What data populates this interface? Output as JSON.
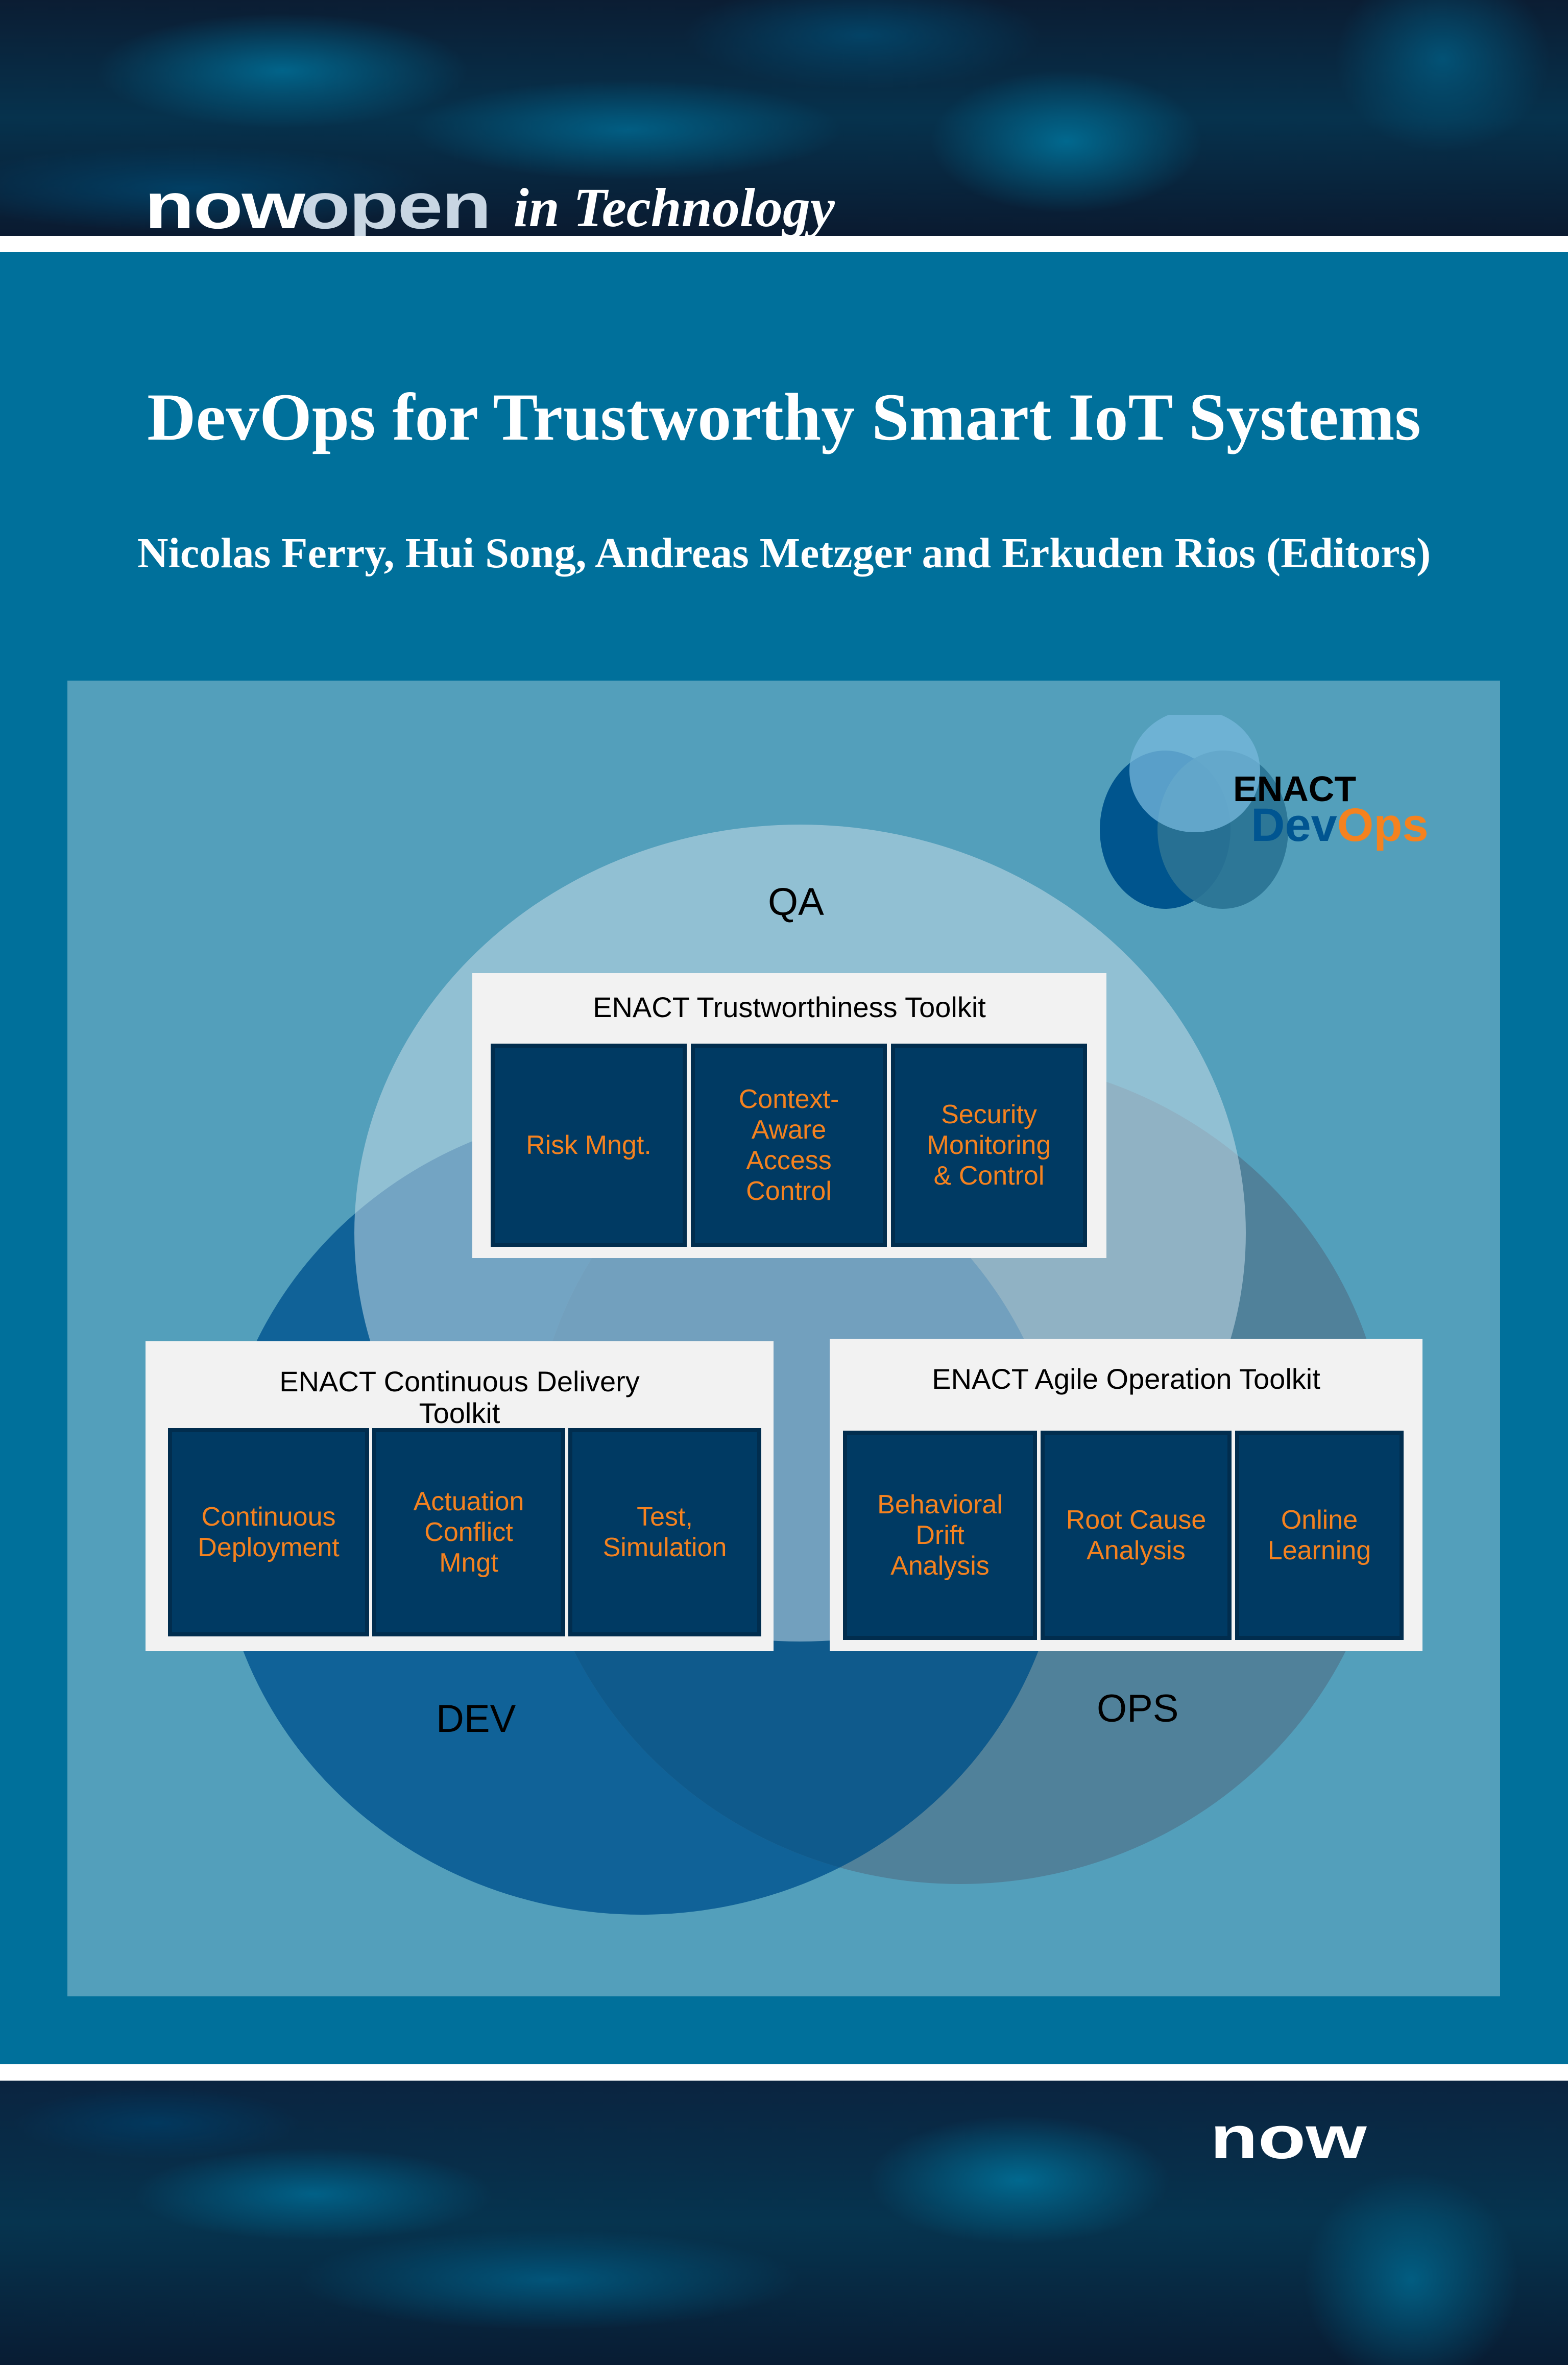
{
  "series": {
    "brand_part1": "now",
    "brand_part2": "open",
    "subtitle": "in Technology"
  },
  "book": {
    "title": "DevOps for Trustworthy Smart IoT Systems",
    "authors": "Nicolas Ferry, Hui Song, Andreas Metzger and Erkuden Rios (Editors)"
  },
  "diagram": {
    "logo": {
      "word1": "ENACT",
      "word2_part1": "Dev",
      "word2_part2": "Ops"
    },
    "regions": {
      "qa": "QA",
      "dev": "DEV",
      "ops": "OPS"
    },
    "toolkits": [
      {
        "title": "ENACT Trustworthiness Toolkit",
        "tiles": [
          "Risk Mngt.",
          "Context-\nAware\nAccess\nControl",
          "Security\nMonitoring\n& Control"
        ]
      },
      {
        "title": "ENACT Continuous Delivery\nToolkit",
        "tiles": [
          "Continuous\nDeployment",
          "Actuation\nConflict\nMngt",
          "Test,\nSimulation"
        ]
      },
      {
        "title": "ENACT Agile Operation Toolkit",
        "tiles": [
          "Behavioral\nDrift\nAnalysis",
          "Root Cause\nAnalysis",
          "Online\nLearning"
        ]
      }
    ]
  },
  "publisher": {
    "logo_text": "now"
  },
  "colors": {
    "cover_blue": "#00709b",
    "panel": "#539fbb",
    "qa_circle": "#a9c7d8",
    "dev_circle": "#106298",
    "ops_circle": "#50819a",
    "tile": "#003a63",
    "tile_text": "#f5821f",
    "toolkit_bg": "#f2f2f2",
    "open_text": "#c8d6e3"
  }
}
